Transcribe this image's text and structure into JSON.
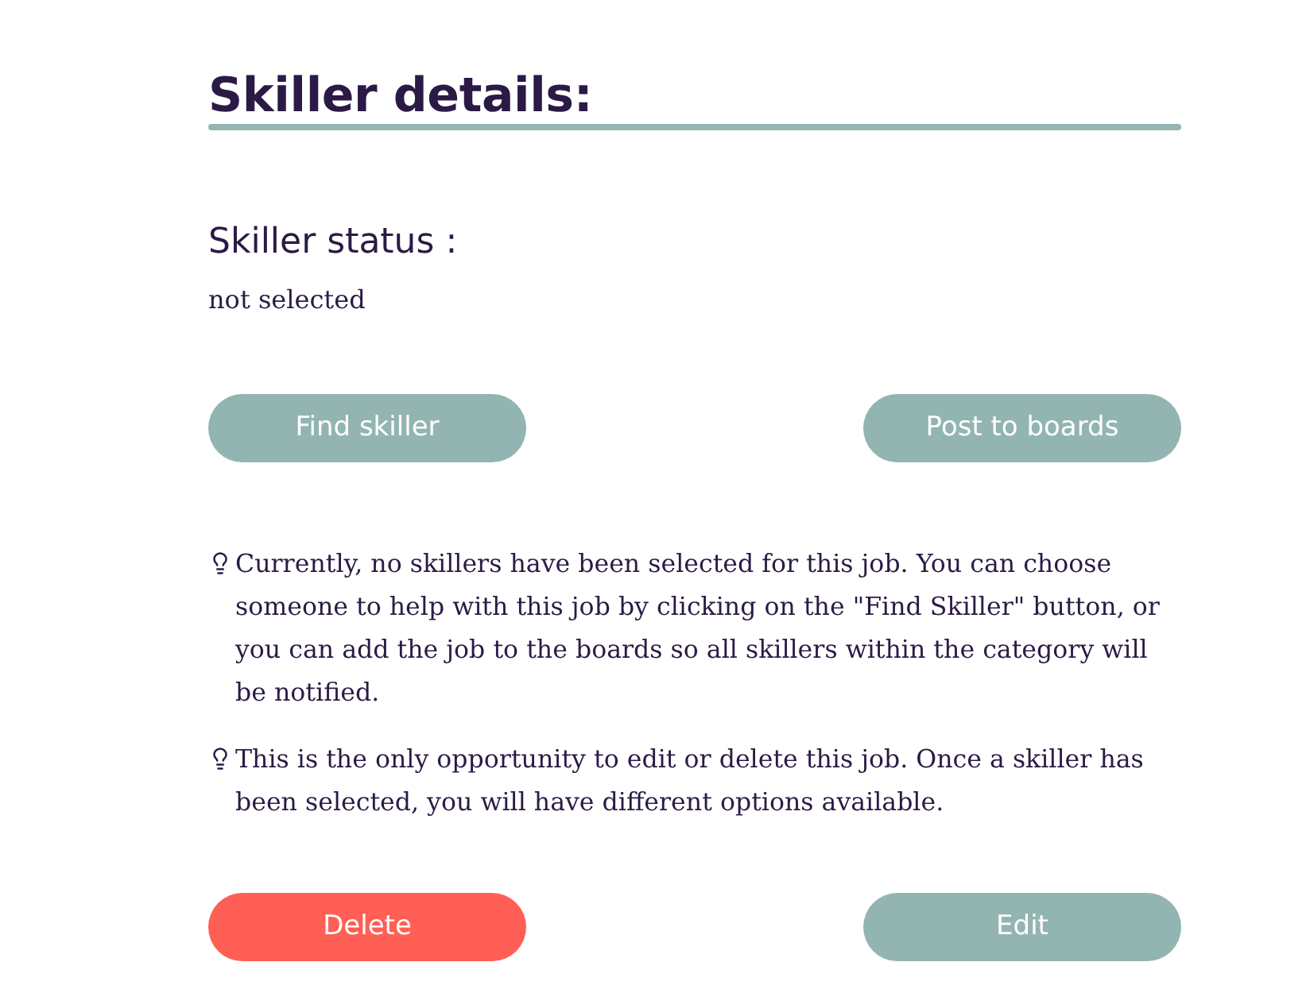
{
  "section": {
    "title": "Skiller details:"
  },
  "status": {
    "label": "Skiller status :",
    "value": "not selected"
  },
  "top_buttons": [
    {
      "label": "Find skiller",
      "kind": "primary"
    },
    {
      "label": "Post to boards",
      "kind": "primary"
    }
  ],
  "tips": [
    "Currently, no skillers have been selected for this job. You can choose someone to help with this job by clicking on the \"Find Skiller\" button, or you can add the job to the boards so all skillers within the category will be notified.",
    "This is the only opportunity to edit or delete this job. Once a skiller has been selected, you will have different options available."
  ],
  "bottom_buttons": [
    {
      "label": "Delete",
      "kind": "danger"
    },
    {
      "label": "Edit",
      "kind": "primary"
    }
  ]
}
